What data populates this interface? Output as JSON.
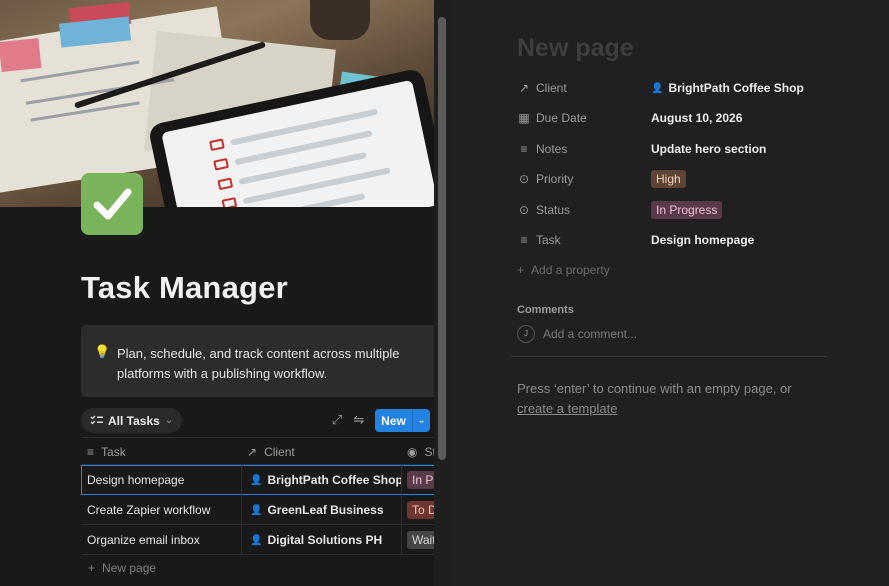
{
  "left": {
    "page_title": "Task Manager",
    "callout": {
      "icon": "lightbulb-icon",
      "text": "Plan, schedule, and track content across multiple platforms with a publishing workflow."
    },
    "view": {
      "label": "All Tasks"
    },
    "new_button": {
      "label": "New"
    },
    "table": {
      "headers": {
        "task": "Task",
        "client": "Client",
        "status": "Status"
      },
      "rows": [
        {
          "task": "Design homepage",
          "client": "BrightPath Coffee Shop",
          "status": "In Progress",
          "status_color": "#5a3a4a",
          "status_text_color": "#f0c2d8"
        },
        {
          "task": "Create Zapier workflow",
          "client": "GreenLeaf Business",
          "status": "To Do",
          "status_color": "#6e3630",
          "status_text_color": "#f5c4bc"
        },
        {
          "task": "Organize email inbox",
          "client": "Digital Solutions PH",
          "status": "Waiting",
          "status_color": "#454545",
          "status_text_color": "#d8d8d8"
        }
      ],
      "new_page": "New page"
    }
  },
  "right": {
    "title_placeholder": "New page",
    "properties": {
      "client": {
        "name": "Client",
        "value": "BrightPath Coffee Shop"
      },
      "due_date": {
        "name": "Due Date",
        "value": "August 10, 2026"
      },
      "notes": {
        "name": "Notes",
        "value": "Update hero section"
      },
      "priority": {
        "name": "Priority",
        "value": "High",
        "color": "#5f4435",
        "text_color": "#f1d1bc"
      },
      "status": {
        "name": "Status",
        "value": "In Progress",
        "color": "#5a3a4a",
        "text_color": "#f0c2d8"
      },
      "task": {
        "name": "Task",
        "value": "Design homepage"
      }
    },
    "add_property": "Add a property",
    "comments_heading": "Comments",
    "avatar_initial": "J",
    "comment_placeholder": "Add a comment...",
    "hint_line1": "Press ‘enter’ to continue with an empty page, or",
    "hint_link": "create a template"
  },
  "colors": {
    "accent": "#2383e2",
    "icon_bg": "#79b35a"
  }
}
